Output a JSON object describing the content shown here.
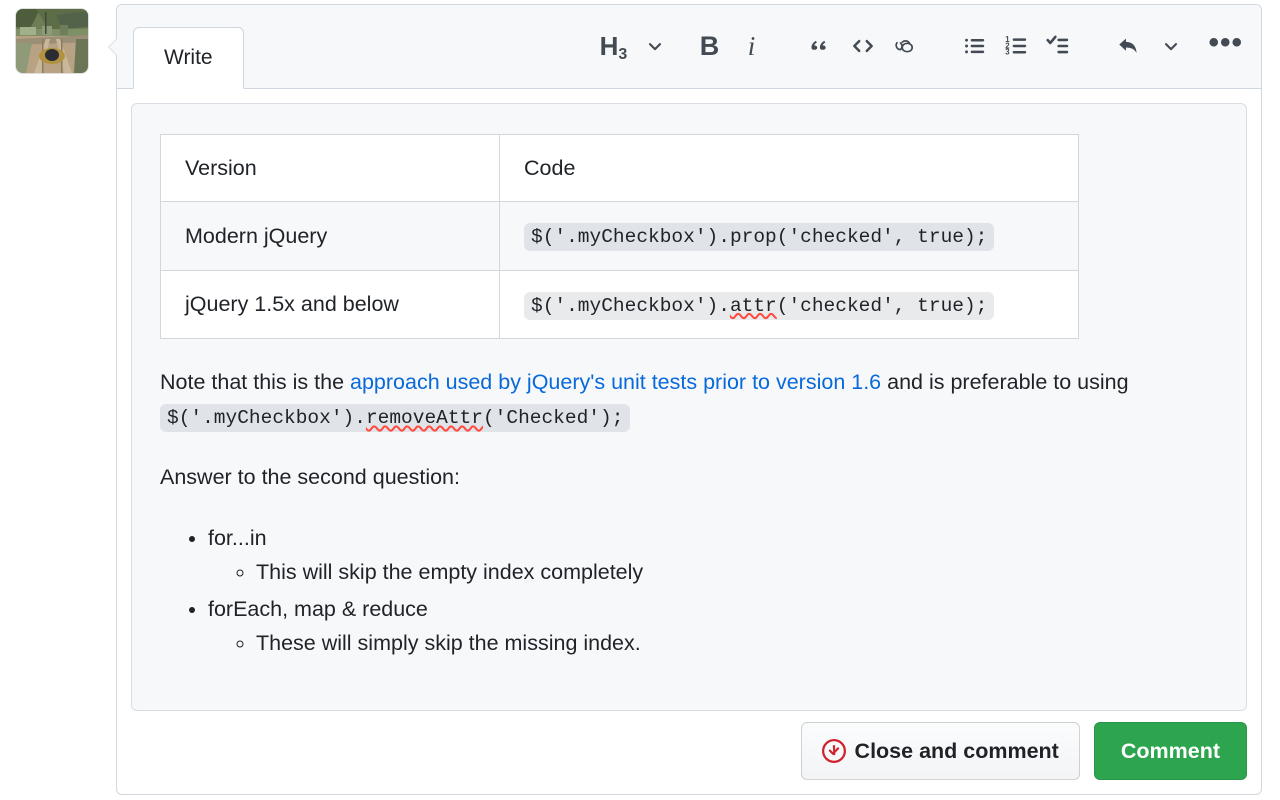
{
  "avatar": {
    "alt_name": "user-avatar-railway-photo"
  },
  "tabs": [
    {
      "label": "Write",
      "selected": true
    }
  ],
  "toolbar": {
    "heading_label": "H",
    "heading_level": "3",
    "items": [
      {
        "name": "heading-picker",
        "label": "H3"
      },
      {
        "name": "heading-chevron-icon",
        "label": "chevron-down"
      },
      {
        "name": "bold-button",
        "label": "B"
      },
      {
        "name": "italic-button",
        "label": "i"
      },
      {
        "name": "quote-button",
        "label": "“"
      },
      {
        "name": "code-button",
        "label": "<>"
      },
      {
        "name": "link-button",
        "label": "link-icon"
      },
      {
        "name": "unordered-list-button",
        "label": "bulleted-list-icon"
      },
      {
        "name": "ordered-list-button",
        "label": "numbered-list-icon"
      },
      {
        "name": "task-list-button",
        "label": "task-list-icon"
      },
      {
        "name": "reply-button",
        "label": "reply-arrow-icon"
      },
      {
        "name": "reply-chevron-icon",
        "label": "chevron-down"
      },
      {
        "name": "more-options-button",
        "label": "•••"
      }
    ],
    "bold_label": "B",
    "italic_label": "i",
    "quote_label": "““",
    "code_label": "<>",
    "more_label": "•••"
  },
  "table": {
    "headers": [
      "Version",
      "Code"
    ],
    "rows": [
      {
        "version": "Modern jQuery",
        "code": "$('.myCheckbox').prop('checked', true);",
        "code_pre": "$('.myCheckbox').",
        "code_misspelled": "",
        "code_post": "prop('checked', true);"
      },
      {
        "version": "jQuery 1.5x and below",
        "code": "$('.myCheckbox').attr('checked', true);",
        "code_pre": "$('.myCheckbox').",
        "code_misspelled": "attr",
        "code_post": "('checked', true);"
      }
    ]
  },
  "paragraphs": {
    "note_pre": "Note that this is the ",
    "note_link": "approach used by jQuery's unit tests prior to version 1.6",
    "note_mid": " and is preferable to using ",
    "note_code_pre": "$('.myCheckbox').",
    "note_code_misspelled": "removeAttr",
    "note_code_post": "('Checked');",
    "answer_intro": "Answer to the second question:"
  },
  "list": [
    {
      "label": "for...in",
      "sub": [
        "This will skip the empty index completely"
      ]
    },
    {
      "label": "forEach, map & reduce",
      "sub": [
        "These will simply skip the missing index."
      ]
    }
  ],
  "footer": {
    "close_and_comment_label": "Close and comment",
    "comment_label": "Comment"
  },
  "colors": {
    "link": "#0969da",
    "primary_button": "#2da44e",
    "close_icon": "#cf222e",
    "border": "#d0d7de",
    "surface": "#f6f8fa",
    "text": "#1f2328",
    "spellcheck_underline": "#ff4a3d"
  }
}
